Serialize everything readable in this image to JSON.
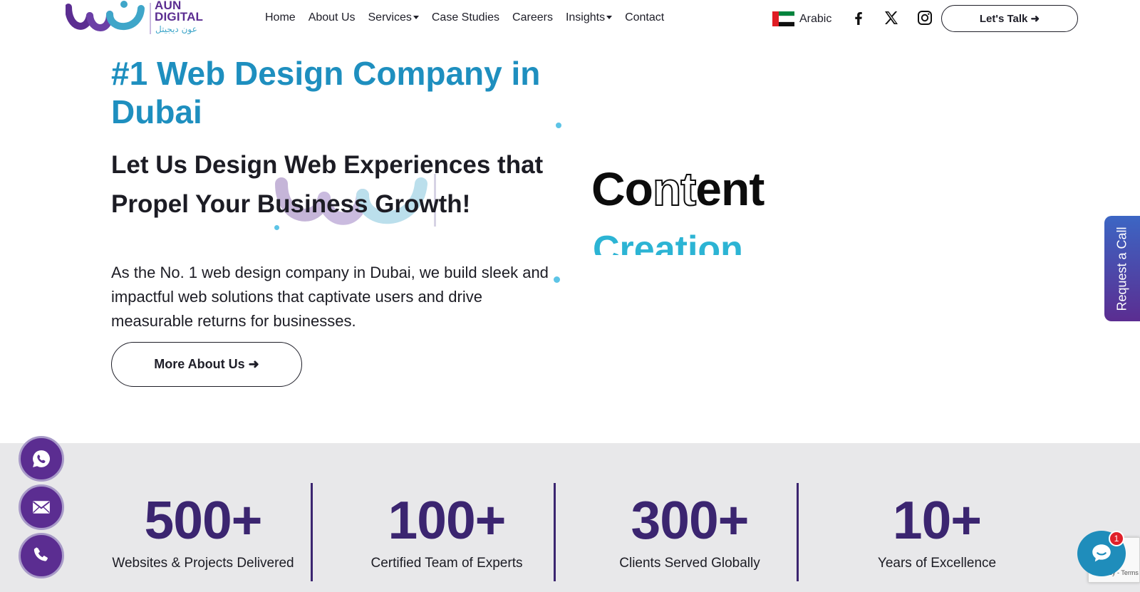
{
  "brand": {
    "name_en_line1": "AUN",
    "name_en_line2": "DIGITAL",
    "name_ar": "عون ديجيتل",
    "primary_color": "#5b2d91",
    "accent_color": "#1e8fbf"
  },
  "nav": {
    "items": [
      {
        "label": "Home",
        "dropdown": false
      },
      {
        "label": "About Us",
        "dropdown": false
      },
      {
        "label": "Services",
        "dropdown": true
      },
      {
        "label": "Case Studies",
        "dropdown": false
      },
      {
        "label": "Careers",
        "dropdown": false
      },
      {
        "label": "Insights",
        "dropdown": true
      },
      {
        "label": "Contact",
        "dropdown": false
      }
    ],
    "language": "Arabic",
    "social_icons": [
      "facebook-icon",
      "x-twitter-icon",
      "instagram-icon"
    ],
    "cta": "Let's Talk ➜"
  },
  "hero": {
    "title": "#1 Web Design Company in Dubai",
    "subtitle": "Let Us Design Web Experiences that Propel Your Business Growth!",
    "description": "As the No. 1 web design company in Dubai, we build sleek and impactful web solutions that captivate users and drive measurable returns for businesses.",
    "button": "More About Us ➜",
    "graphic_line1_a": "Co",
    "graphic_line1_b": "nt",
    "graphic_line1_c": "e",
    "graphic_line1_d": "nt",
    "graphic_line2": "Creation"
  },
  "side_tab": "Request a Call",
  "stats": [
    {
      "value": "500+",
      "label": "Websites & Projects Delivered"
    },
    {
      "value": "100+",
      "label": "Certified Team of Experts"
    },
    {
      "value": "300+",
      "label": "Clients Served Globally"
    },
    {
      "value": "10+",
      "label": "Years of Excellence"
    }
  ],
  "floating_contacts": [
    "whatsapp-icon",
    "email-icon",
    "phone-icon"
  ],
  "chat": {
    "badge_count": "1"
  },
  "recaptcha": {
    "text": "Privacy - Terms"
  }
}
